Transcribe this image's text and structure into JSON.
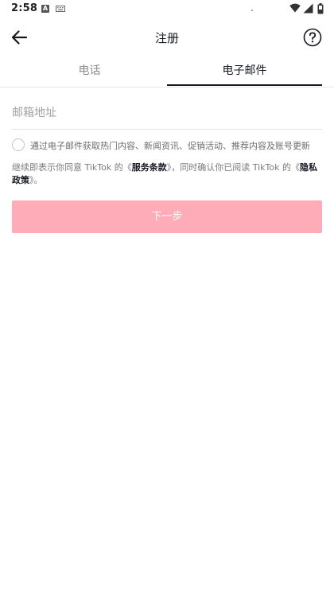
{
  "status_bar": {
    "time": "2:58",
    "notification_icon_letter": "A",
    "icons": [
      "a-notification-icon",
      "keyboard-icon",
      "wifi-icon",
      "signal-icon",
      "battery-icon"
    ]
  },
  "header": {
    "title": "注册",
    "back_icon": "arrow-left-icon",
    "help_icon": "question-circle-icon"
  },
  "tabs": [
    {
      "label": "电话",
      "active": false
    },
    {
      "label": "电子邮件",
      "active": true
    }
  ],
  "email_input": {
    "placeholder": "邮箱地址",
    "value": ""
  },
  "consent": {
    "checked": false,
    "text": "通过电子邮件获取热门内容、新闻资讯、促销活动、推荐内容及账号更新"
  },
  "terms": {
    "prefix": "继续即表示你同意 TikTok 的《",
    "terms_link": "服务条款",
    "middle": "》，同时确认你已阅读 TikTok 的《",
    "privacy_link": "隐私政策",
    "suffix": "》。"
  },
  "next_button": {
    "label": "下一步",
    "color": "#feacb8"
  }
}
